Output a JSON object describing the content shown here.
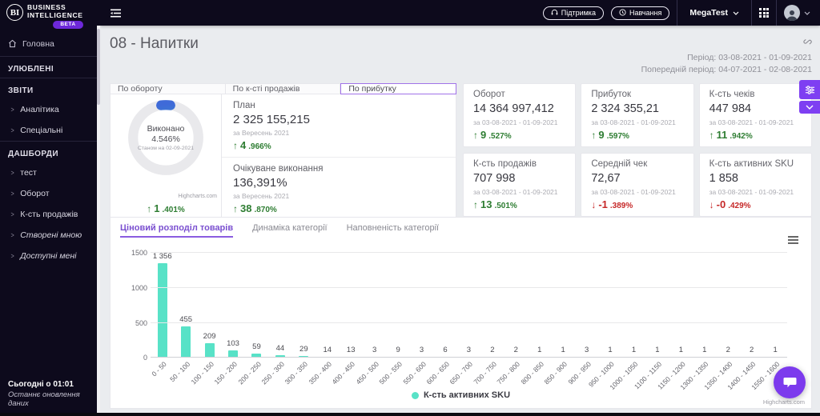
{
  "logo": {
    "mark": "BI",
    "line1": "BUSINESS",
    "line2": "INTELLIGENCE",
    "badge": "BETA"
  },
  "topbar": {
    "support": "Підтримка",
    "training": "Навчання",
    "account": "MegaTest"
  },
  "sidebar": {
    "home": "Головна",
    "sections": [
      {
        "title": "УЛЮБЛЕНІ",
        "items": []
      },
      {
        "title": "ЗВІТИ",
        "items": [
          {
            "label": "Аналітика"
          },
          {
            "label": "Спеціальні"
          }
        ]
      },
      {
        "title": "ДАШБОРДИ",
        "items": [
          {
            "label": "тест"
          },
          {
            "label": "Оборот"
          },
          {
            "label": "К-сть продажів"
          },
          {
            "label": "Створені мною",
            "italic": true
          },
          {
            "label": "Доступні мені",
            "italic": true
          }
        ]
      }
    ],
    "footer": {
      "time": "Сьогодні о 01:01",
      "caption": "Останнє оновлення даних"
    }
  },
  "header": {
    "title": "08 - Напитки",
    "period": "Період: 03-08-2021 - 01-09-2021",
    "prev_period": "Попередній період: 04-07-2021 - 02-08-2021"
  },
  "view_tabs": [
    {
      "label": "По обороту"
    },
    {
      "label": "По к-сті продажів"
    },
    {
      "label": "По прибутку",
      "active": true
    }
  ],
  "gauge": {
    "label": "Виконано",
    "value": "4.546%",
    "percent": 4.546,
    "caption": "Станом на 02-09-2021",
    "credit": "Highcharts.com",
    "delta": "1.401%",
    "direction": "up"
  },
  "plan_rows": [
    {
      "title": "План",
      "value": "2 325 155,215",
      "period": "за Вересень 2021",
      "delta": "4.966%",
      "direction": "up"
    },
    {
      "title": "Очікуване виконання",
      "value": "136,391%",
      "period": "за Вересень 2021",
      "delta": "38.870%",
      "direction": "up"
    }
  ],
  "kpis": [
    {
      "title": "Оборот",
      "value": "14 364 997,412",
      "period": "за 03-08-2021 - 01-09-2021",
      "delta": "9.527%",
      "direction": "up"
    },
    {
      "title": "Прибуток",
      "value": "2 324 355,21",
      "period": "за 03-08-2021 - 01-09-2021",
      "delta": "9.597%",
      "direction": "up"
    },
    {
      "title": "К-сть чеків",
      "value": "447 984",
      "period": "за 03-08-2021 - 01-09-2021",
      "delta": "11.942%",
      "direction": "up"
    },
    {
      "title": "К-сть продажів",
      "value": "707 998",
      "period": "за 03-08-2021 - 01-09-2021",
      "delta": "13.501%",
      "direction": "up"
    },
    {
      "title": "Середній чек",
      "value": "72,67",
      "period": "за 03-08-2021 - 01-09-2021",
      "delta": "-1.389%",
      "direction": "down"
    },
    {
      "title": "К-сть активних SKU",
      "value": "1 858",
      "period": "за 03-08-2021 - 01-09-2021",
      "delta": "-0.429%",
      "direction": "down"
    }
  ],
  "chart_tabs": [
    {
      "label": "Ціновий розподіл товарів",
      "active": true
    },
    {
      "label": "Динаміка категорії"
    },
    {
      "label": "Наповненість категорії"
    }
  ],
  "chart_data": {
    "type": "bar",
    "title": "Ціновий розподіл товарів",
    "series_name": "К-сть активних SKU",
    "categories": [
      "0 - 50",
      "50 - 100",
      "100 - 150",
      "150 - 200",
      "200 - 250",
      "250 - 300",
      "300 - 350",
      "350 - 400",
      "400 - 450",
      "450 - 500",
      "500 - 550",
      "550 - 600",
      "600 - 650",
      "650 - 700",
      "700 - 750",
      "750 - 800",
      "800 - 850",
      "850 - 900",
      "900 - 950",
      "950 - 1000",
      "1000 - 1050",
      "1100 - 1150",
      "1150 - 1200",
      "1300 - 1350",
      "1350 - 1400",
      "1400 - 1450",
      "1550 - 1600"
    ],
    "values": [
      1356,
      455,
      209,
      103,
      59,
      44,
      29,
      14,
      13,
      3,
      9,
      3,
      6,
      3,
      2,
      2,
      1,
      1,
      3,
      1,
      1,
      1,
      1,
      1,
      2,
      2,
      1
    ],
    "value_labels": [
      "1 356",
      "455",
      "209",
      "103",
      "59",
      "44",
      "29",
      "14",
      "13",
      "3",
      "9",
      "3",
      "6",
      "3",
      "2",
      "2",
      "1",
      "1",
      "3",
      "1",
      "1",
      "1",
      "1",
      "1",
      "2",
      "2",
      "1"
    ],
    "yticks": [
      0,
      500,
      1000,
      1500
    ],
    "ylim": [
      0,
      1500
    ],
    "xlabel": "",
    "ylabel": "",
    "grid": true,
    "legend_position": "bottom",
    "bar_color": "#58e2c7",
    "credit": "Highcharts.com"
  },
  "colors": {
    "accent": "#7c3aed",
    "topbar_bg": "#0d0a1c",
    "positive": "#2e7d32",
    "negative": "#c62828",
    "bar": "#58e2c7",
    "beta_badge": "#6d28d9"
  },
  "icons": {
    "chevron_right": ">",
    "up_arrow": "↑",
    "down_arrow": "↓"
  }
}
